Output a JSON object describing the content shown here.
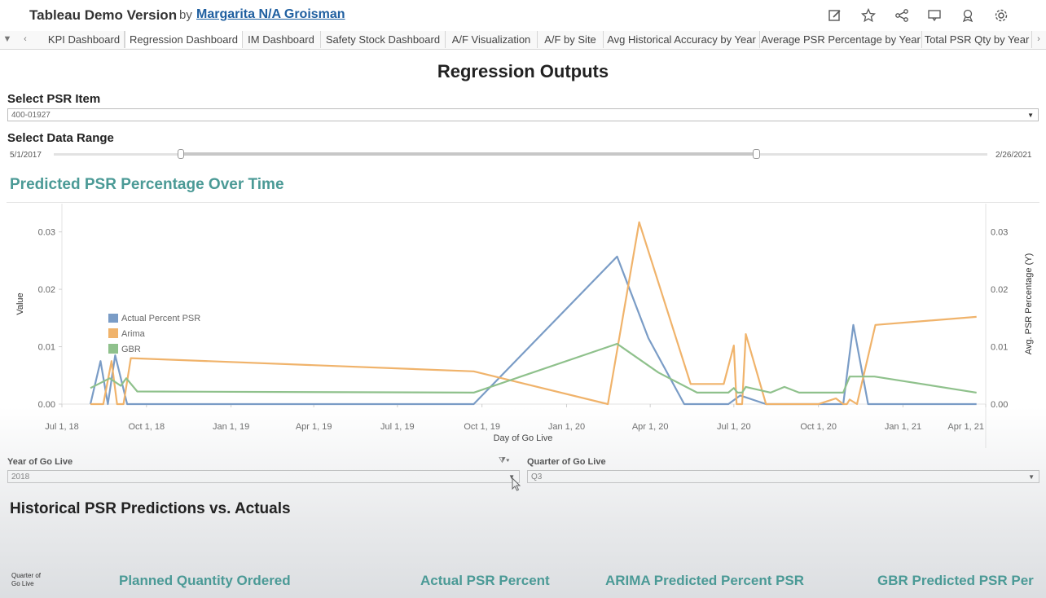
{
  "header": {
    "title": "Tableau Demo Version",
    "by": "by",
    "author": "Margarita N/A Groisman",
    "icons": [
      "edit-icon",
      "star-icon",
      "share-icon",
      "comment-icon",
      "badge-icon",
      "gear-icon"
    ]
  },
  "tabs": [
    "KPI Dashboard",
    "Regression Dashboard",
    "IM Dashboard",
    "Safety Stock Dashboard",
    "A/F Visualization",
    "A/F by Site",
    "Avg Historical Accuracy by Year",
    "Average PSR Percentage by Year",
    "Total PSR Qty by Year"
  ],
  "active_tab": "Regression Dashboard",
  "page_title": "Regression Outputs",
  "psr_item": {
    "label": "Select PSR Item",
    "value": "400-01927"
  },
  "data_range": {
    "label": "Select Data Range",
    "start": "5/1/2017",
    "end": "2/26/2021",
    "handle_start_fraction": 0.136,
    "handle_end_fraction": 0.752
  },
  "chart_title": "Predicted PSR Percentage Over Time",
  "chart_data": {
    "type": "line",
    "xlabel": "Day of Go Live",
    "ylabel": "Value",
    "ylabel_right": "Avg. PSR Percentage (Y)",
    "x_ticks": [
      "Jul 1, 18",
      "Oct 1, 18",
      "Jan 1, 19",
      "Apr 1, 19",
      "Jul 1, 19",
      "Oct 1, 19",
      "Jan 1, 20",
      "Apr 1, 20",
      "Jul 1, 20",
      "Oct 1, 20",
      "Jan 1, 21",
      "Apr 1, 21"
    ],
    "y_ticks": [
      "0.00",
      "0.01",
      "0.02",
      "0.03"
    ],
    "ylim": [
      0,
      0.0335
    ],
    "xlim": [
      "2018-07-01",
      "2021-04-01"
    ],
    "legend_placement": "left",
    "series": [
      {
        "name": "Actual Percent PSR",
        "color": "#7a9cc6",
        "points": [
          [
            "2018-08-01",
            0
          ],
          [
            "2018-08-12",
            0.0075
          ],
          [
            "2018-08-20",
            0
          ],
          [
            "2018-08-28",
            0.0085
          ],
          [
            "2018-09-10",
            0
          ],
          [
            "2019-09-22",
            0
          ],
          [
            "2020-02-25",
            0.0257
          ],
          [
            "2020-03-30",
            0.0115
          ],
          [
            "2020-05-08",
            0
          ],
          [
            "2020-06-25",
            0
          ],
          [
            "2020-07-08",
            0.0015
          ],
          [
            "2020-08-05",
            0
          ],
          [
            "2020-10-28",
            0
          ],
          [
            "2020-11-08",
            0.0138
          ],
          [
            "2020-11-24",
            0
          ],
          [
            "2021-03-22",
            0
          ]
        ]
      },
      {
        "name": "Arima",
        "color": "#f0b36b",
        "points": [
          [
            "2018-08-01",
            0
          ],
          [
            "2018-08-15",
            0
          ],
          [
            "2018-08-24",
            0.0075
          ],
          [
            "2018-08-30",
            0
          ],
          [
            "2018-09-06",
            0
          ],
          [
            "2018-09-14",
            0.008
          ],
          [
            "2019-09-22",
            0.0057
          ],
          [
            "2020-02-15",
            0
          ],
          [
            "2020-03-20",
            0.0317
          ],
          [
            "2020-05-15",
            0.0035
          ],
          [
            "2020-06-20",
            0.0035
          ],
          [
            "2020-07-01",
            0.0102
          ],
          [
            "2020-07-04",
            0
          ],
          [
            "2020-07-10",
            0
          ],
          [
            "2020-07-14",
            0.0122
          ],
          [
            "2020-08-05",
            0
          ],
          [
            "2020-10-01",
            0
          ],
          [
            "2020-10-20",
            0.001
          ],
          [
            "2020-10-28",
            0
          ],
          [
            "2020-11-01",
            0
          ],
          [
            "2020-11-04",
            0.0008
          ],
          [
            "2020-11-12",
            0
          ],
          [
            "2020-12-02",
            0.0138
          ],
          [
            "2021-03-22",
            0.0152
          ]
        ]
      },
      {
        "name": "GBR",
        "color": "#8fc18c",
        "points": [
          [
            "2018-08-01",
            0.0028
          ],
          [
            "2018-08-22",
            0.0045
          ],
          [
            "2018-09-03",
            0.0032
          ],
          [
            "2018-09-09",
            0.0045
          ],
          [
            "2018-09-21",
            0.0022
          ],
          [
            "2019-09-22",
            0.002
          ],
          [
            "2020-02-25",
            0.0105
          ],
          [
            "2020-04-10",
            0.0055
          ],
          [
            "2020-05-22",
            0.002
          ],
          [
            "2020-06-25",
            0.002
          ],
          [
            "2020-07-01",
            0.0028
          ],
          [
            "2020-07-05",
            0.002
          ],
          [
            "2020-07-10",
            0.002
          ],
          [
            "2020-07-14",
            0.003
          ],
          [
            "2020-08-10",
            0.002
          ],
          [
            "2020-08-25",
            0.003
          ],
          [
            "2020-09-10",
            0.002
          ],
          [
            "2020-10-28",
            0.002
          ],
          [
            "2020-11-04",
            0.0048
          ],
          [
            "2020-12-01",
            0.0048
          ],
          [
            "2021-03-22",
            0.002
          ]
        ]
      }
    ]
  },
  "filters": {
    "year_label": "Year of Go Live",
    "year_value": "2018",
    "quarter_label": "Quarter of Go Live",
    "quarter_value": "Q3"
  },
  "historical": {
    "title": "Historical PSR Predictions vs. Actuals",
    "row_header": "Quarter of Go Live",
    "columns": [
      "Planned Quantity Ordered",
      "Actual PSR Percent",
      "ARIMA Predicted Percent PSR",
      "GBR Predicted PSR Per"
    ]
  }
}
